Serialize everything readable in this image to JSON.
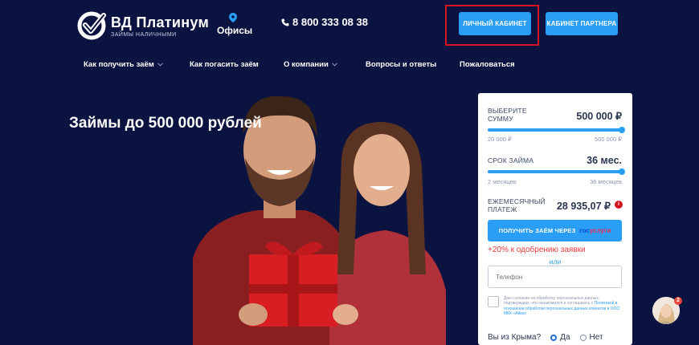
{
  "header": {
    "logo_name": "ВД Платинум",
    "logo_tagline": "ЗАЙМЫ НАЛИЧНЫМИ",
    "offices_label": "Офисы",
    "phone": "8 800 333 08 38",
    "cabinet_button": "ЛИЧНЫЙ КАБИНЕТ",
    "partner_button": "КАБИНЕТ ПАРТНЕРА"
  },
  "nav": {
    "items": [
      {
        "label": "Как получить заём",
        "has_dropdown": true
      },
      {
        "label": "Как погасить заём",
        "has_dropdown": false
      },
      {
        "label": "О компании",
        "has_dropdown": true
      },
      {
        "label": "Вопросы и ответы",
        "has_dropdown": false
      },
      {
        "label": "Пожаловаться",
        "has_dropdown": false
      }
    ]
  },
  "hero": {
    "title": "Займы до 500 000 рублей"
  },
  "calculator": {
    "amount": {
      "label_line1": "ВЫБЕРИТЕ",
      "label_line2": "СУММУ",
      "value": "500 000 ₽",
      "min": "20 000 ₽",
      "max": "500 000 ₽",
      "fraction": 1.0
    },
    "term": {
      "label": "СРОК ЗАЙМА",
      "value": "36 мес.",
      "min": "2 месяцев",
      "max": "36 месяцев",
      "fraction": 1.0
    },
    "payment": {
      "label_line1": "ЕЖЕМЕСЯЧНЫЙ",
      "label_line2": "ПЛАТЕЖ",
      "value": "28 935,07 ₽",
      "info_icon": "i"
    },
    "gos_button_text": "ПОЛУЧИТЬ ЗАЁМ ЧЕРЕЗ",
    "gos_logo_part1": "гос",
    "gos_logo_part2": "услуги",
    "promo": "+20% к одобрению заявки",
    "or_label": "или",
    "phone_placeholder": "Телефон",
    "consent_text": "Даю согласие на обработку персональных данных, подтверждаю, что ознакомился и соглашаюсь с",
    "consent_link": "Политикой в отношении обработки персональных данных клиентов в ООО МКК «Айва»",
    "crimea_question": "Вы из Крыма?",
    "crimea_yes": "Да",
    "crimea_no": "Нет",
    "crimea_selected": "Да"
  },
  "chat": {
    "badge_count": "2"
  },
  "colors": {
    "background": "#0b1340",
    "accent": "#2a9df4",
    "highlight": "#d4141e",
    "promo": "#e83a3a"
  }
}
